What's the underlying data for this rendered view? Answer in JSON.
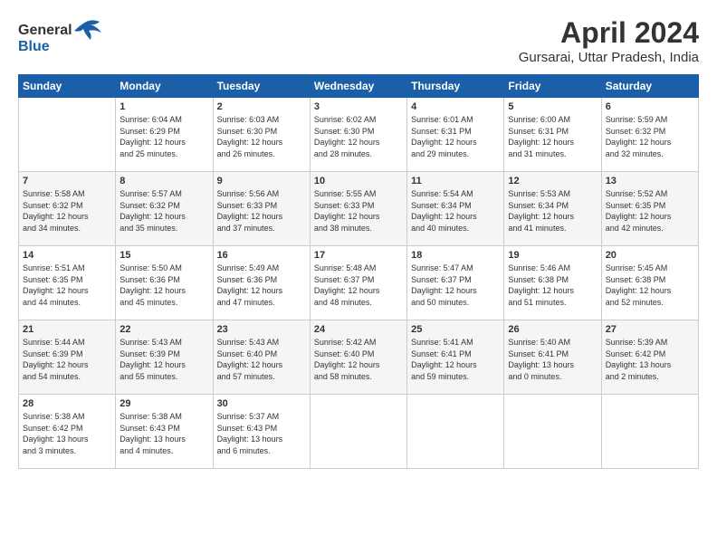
{
  "header": {
    "logo_line1": "General",
    "logo_line2": "Blue",
    "title": "April 2024",
    "subtitle": "Gursarai, Uttar Pradesh, India"
  },
  "days_of_week": [
    "Sunday",
    "Monday",
    "Tuesday",
    "Wednesday",
    "Thursday",
    "Friday",
    "Saturday"
  ],
  "weeks": [
    [
      {
        "day": "",
        "detail": ""
      },
      {
        "day": "1",
        "detail": "Sunrise: 6:04 AM\nSunset: 6:29 PM\nDaylight: 12 hours\nand 25 minutes."
      },
      {
        "day": "2",
        "detail": "Sunrise: 6:03 AM\nSunset: 6:30 PM\nDaylight: 12 hours\nand 26 minutes."
      },
      {
        "day": "3",
        "detail": "Sunrise: 6:02 AM\nSunset: 6:30 PM\nDaylight: 12 hours\nand 28 minutes."
      },
      {
        "day": "4",
        "detail": "Sunrise: 6:01 AM\nSunset: 6:31 PM\nDaylight: 12 hours\nand 29 minutes."
      },
      {
        "day": "5",
        "detail": "Sunrise: 6:00 AM\nSunset: 6:31 PM\nDaylight: 12 hours\nand 31 minutes."
      },
      {
        "day": "6",
        "detail": "Sunrise: 5:59 AM\nSunset: 6:32 PM\nDaylight: 12 hours\nand 32 minutes."
      }
    ],
    [
      {
        "day": "7",
        "detail": "Sunrise: 5:58 AM\nSunset: 6:32 PM\nDaylight: 12 hours\nand 34 minutes."
      },
      {
        "day": "8",
        "detail": "Sunrise: 5:57 AM\nSunset: 6:32 PM\nDaylight: 12 hours\nand 35 minutes."
      },
      {
        "day": "9",
        "detail": "Sunrise: 5:56 AM\nSunset: 6:33 PM\nDaylight: 12 hours\nand 37 minutes."
      },
      {
        "day": "10",
        "detail": "Sunrise: 5:55 AM\nSunset: 6:33 PM\nDaylight: 12 hours\nand 38 minutes."
      },
      {
        "day": "11",
        "detail": "Sunrise: 5:54 AM\nSunset: 6:34 PM\nDaylight: 12 hours\nand 40 minutes."
      },
      {
        "day": "12",
        "detail": "Sunrise: 5:53 AM\nSunset: 6:34 PM\nDaylight: 12 hours\nand 41 minutes."
      },
      {
        "day": "13",
        "detail": "Sunrise: 5:52 AM\nSunset: 6:35 PM\nDaylight: 12 hours\nand 42 minutes."
      }
    ],
    [
      {
        "day": "14",
        "detail": "Sunrise: 5:51 AM\nSunset: 6:35 PM\nDaylight: 12 hours\nand 44 minutes."
      },
      {
        "day": "15",
        "detail": "Sunrise: 5:50 AM\nSunset: 6:36 PM\nDaylight: 12 hours\nand 45 minutes."
      },
      {
        "day": "16",
        "detail": "Sunrise: 5:49 AM\nSunset: 6:36 PM\nDaylight: 12 hours\nand 47 minutes."
      },
      {
        "day": "17",
        "detail": "Sunrise: 5:48 AM\nSunset: 6:37 PM\nDaylight: 12 hours\nand 48 minutes."
      },
      {
        "day": "18",
        "detail": "Sunrise: 5:47 AM\nSunset: 6:37 PM\nDaylight: 12 hours\nand 50 minutes."
      },
      {
        "day": "19",
        "detail": "Sunrise: 5:46 AM\nSunset: 6:38 PM\nDaylight: 12 hours\nand 51 minutes."
      },
      {
        "day": "20",
        "detail": "Sunrise: 5:45 AM\nSunset: 6:38 PM\nDaylight: 12 hours\nand 52 minutes."
      }
    ],
    [
      {
        "day": "21",
        "detail": "Sunrise: 5:44 AM\nSunset: 6:39 PM\nDaylight: 12 hours\nand 54 minutes."
      },
      {
        "day": "22",
        "detail": "Sunrise: 5:43 AM\nSunset: 6:39 PM\nDaylight: 12 hours\nand 55 minutes."
      },
      {
        "day": "23",
        "detail": "Sunrise: 5:43 AM\nSunset: 6:40 PM\nDaylight: 12 hours\nand 57 minutes."
      },
      {
        "day": "24",
        "detail": "Sunrise: 5:42 AM\nSunset: 6:40 PM\nDaylight: 12 hours\nand 58 minutes."
      },
      {
        "day": "25",
        "detail": "Sunrise: 5:41 AM\nSunset: 6:41 PM\nDaylight: 12 hours\nand 59 minutes."
      },
      {
        "day": "26",
        "detail": "Sunrise: 5:40 AM\nSunset: 6:41 PM\nDaylight: 13 hours\nand 0 minutes."
      },
      {
        "day": "27",
        "detail": "Sunrise: 5:39 AM\nSunset: 6:42 PM\nDaylight: 13 hours\nand 2 minutes."
      }
    ],
    [
      {
        "day": "28",
        "detail": "Sunrise: 5:38 AM\nSunset: 6:42 PM\nDaylight: 13 hours\nand 3 minutes."
      },
      {
        "day": "29",
        "detail": "Sunrise: 5:38 AM\nSunset: 6:43 PM\nDaylight: 13 hours\nand 4 minutes."
      },
      {
        "day": "30",
        "detail": "Sunrise: 5:37 AM\nSunset: 6:43 PM\nDaylight: 13 hours\nand 6 minutes."
      },
      {
        "day": "",
        "detail": ""
      },
      {
        "day": "",
        "detail": ""
      },
      {
        "day": "",
        "detail": ""
      },
      {
        "day": "",
        "detail": ""
      }
    ]
  ]
}
